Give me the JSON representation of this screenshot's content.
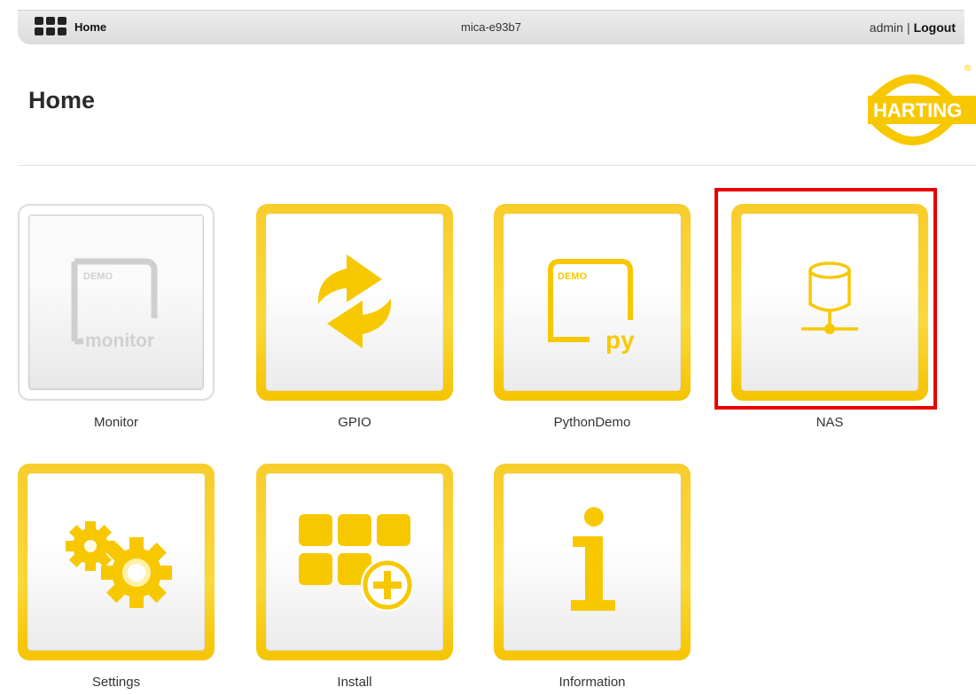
{
  "topbar": {
    "home_label": "Home",
    "device_name": "mica-e93b7",
    "user": "admin",
    "separator": "|",
    "logout_label": "Logout"
  },
  "page": {
    "title": "Home"
  },
  "logo": {
    "text": "HARTING",
    "registered": "®",
    "brand_color": "#f7c800"
  },
  "tiles": [
    {
      "label": "Monitor",
      "icon": "monitor-demo-icon",
      "demo_text": "DEMO",
      "icon_text": "monitor",
      "state": "disabled"
    },
    {
      "label": "GPIO",
      "icon": "sync-arrows-icon"
    },
    {
      "label": "PythonDemo",
      "icon": "python-demo-icon",
      "demo_text": "DEMO",
      "icon_text": "py"
    },
    {
      "label": "NAS",
      "icon": "nas-database-icon",
      "highlighted": true
    },
    {
      "label": "Settings",
      "icon": "gears-icon"
    },
    {
      "label": "Install",
      "icon": "install-apps-icon"
    },
    {
      "label": "Information",
      "icon": "info-icon"
    }
  ],
  "colors": {
    "accent": "#f7c800",
    "highlight": "#e80000"
  }
}
